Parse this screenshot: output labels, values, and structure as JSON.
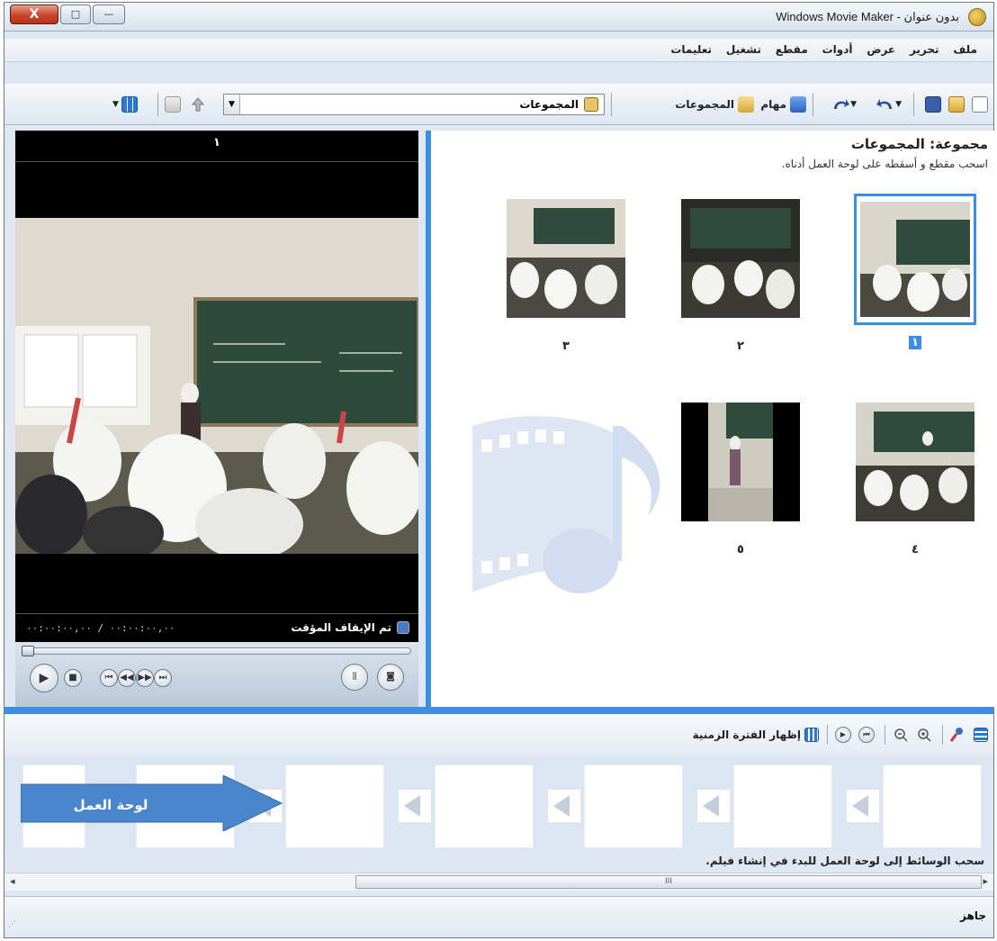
{
  "window": {
    "title": "بدون عنوان - Windows Movie Maker",
    "close_label": "X",
    "max_label": "□",
    "min_label": "—"
  },
  "menu": [
    "ملف",
    "تحرير",
    "عرض",
    "أدوات",
    "مقطع",
    "تشغيل",
    "تعليمات"
  ],
  "toolbar": {
    "tasks_label": "مهام",
    "collections_label": "المجموعات",
    "combo_value": "المجموعات"
  },
  "preview": {
    "title": "١",
    "state": "تم الإيقاف المؤقت",
    "time": "٠٠:٠٠:٠٠,٠٠ / ٠٠:٠٠:٠٠,٠٠",
    "position_fraction": 0
  },
  "collection": {
    "heading": "مجموعة: المجموعات",
    "subtitle": "اسحب مقطع و أسقطه على لوحة العمل أدناه.",
    "clips": [
      {
        "label": "١",
        "selected": true
      },
      {
        "label": "٢",
        "selected": false
      },
      {
        "label": "٣",
        "selected": false
      },
      {
        "label": "٤",
        "selected": false
      },
      {
        "label": "٥",
        "selected": false
      }
    ]
  },
  "storyboard": {
    "timeline_label": "إظهار الفترة الزمنية",
    "arrow_label": "لوحة العمل",
    "hint": "سحب الوسائط إلى لوحة العمل للبدء في إنشاء فيلم."
  },
  "scrollbar": {
    "thumb_grip": "III",
    "left_arrow": "◂",
    "right_arrow": "▸"
  },
  "status": {
    "text": "جاهز"
  },
  "colors": {
    "accent": "#3a8ee6",
    "selection": "#3a8ee6",
    "arrow_fill": "#4a86cc"
  }
}
